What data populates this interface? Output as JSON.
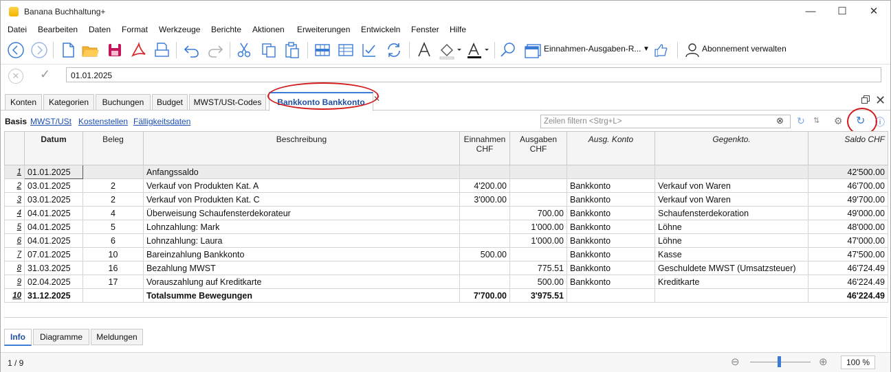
{
  "window": {
    "title": "Banana Buchhaltung+"
  },
  "menu": [
    "Datei",
    "Bearbeiten",
    "Daten",
    "Format",
    "Werkzeuge",
    "Berichte",
    "Aktionen",
    "Erweiterungen",
    "Entwickeln",
    "Fenster",
    "Hilfe"
  ],
  "toolbar": {
    "layout_selector": "Einnahmen-Ausgaben-R...",
    "subscription_label": "Abonnement verwalten"
  },
  "formula_bar": {
    "value": "01.01.2025"
  },
  "tabs": [
    "Konten",
    "Kategorien",
    "Buchungen",
    "Budget",
    "MWST/USt-Codes",
    "Bankkonto Bankkonto"
  ],
  "active_tab": "Bankkonto Bankkonto",
  "views": {
    "active": "Basis",
    "links": [
      "MWST/USt",
      "Kostenstellen",
      "Fälligkeitsdaten"
    ]
  },
  "filter": {
    "placeholder": "Zeilen filtern <Strg+L>"
  },
  "table": {
    "headers": {
      "datum": "Datum",
      "beleg": "Beleg",
      "beschreibung": "Beschreibung",
      "einnahmen": "Einnahmen CHF",
      "ausgaben": "Ausgaben CHF",
      "ausg_konto": "Ausg. Konto",
      "gegenkto": "Gegenkto.",
      "saldo": "Saldo CHF"
    },
    "rows": [
      {
        "n": "1",
        "datum": "01.01.2025",
        "beleg": "",
        "beschreibung": "Anfangssaldo",
        "einnahmen": "",
        "ausgaben": "",
        "konto": "",
        "gegenkto": "",
        "saldo": "42'500.00"
      },
      {
        "n": "2",
        "datum": "03.01.2025",
        "beleg": "2",
        "beschreibung": "Verkauf von Produkten Kat. A",
        "einnahmen": "4'200.00",
        "ausgaben": "",
        "konto": "Bankkonto",
        "gegenkto": "Verkauf von Waren",
        "saldo": "46'700.00"
      },
      {
        "n": "3",
        "datum": "03.01.2025",
        "beleg": "2",
        "beschreibung": "Verkauf von Produkten Kat. C",
        "einnahmen": "3'000.00",
        "ausgaben": "",
        "konto": "Bankkonto",
        "gegenkto": "Verkauf von Waren",
        "saldo": "49'700.00"
      },
      {
        "n": "4",
        "datum": "04.01.2025",
        "beleg": "4",
        "beschreibung": "Überweisung Schaufensterdekorateur",
        "einnahmen": "",
        "ausgaben": "700.00",
        "konto": "Bankkonto",
        "gegenkto": "Schaufensterdekoration",
        "saldo": "49'000.00"
      },
      {
        "n": "5",
        "datum": "04.01.2025",
        "beleg": "5",
        "beschreibung": "Lohnzahlung: Mark",
        "einnahmen": "",
        "ausgaben": "1'000.00",
        "konto": "Bankkonto",
        "gegenkto": "Löhne",
        "saldo": "48'000.00"
      },
      {
        "n": "6",
        "datum": "04.01.2025",
        "beleg": "6",
        "beschreibung": "Lohnzahlung: Laura",
        "einnahmen": "",
        "ausgaben": "1'000.00",
        "konto": "Bankkonto",
        "gegenkto": "Löhne",
        "saldo": "47'000.00"
      },
      {
        "n": "7",
        "datum": "07.01.2025",
        "beleg": "10",
        "beschreibung": "Bareinzahlung Bankkonto",
        "einnahmen": "500.00",
        "ausgaben": "",
        "konto": "Bankkonto",
        "gegenkto": "Kasse",
        "saldo": "47'500.00"
      },
      {
        "n": "8",
        "datum": "31.03.2025",
        "beleg": "16",
        "beschreibung": "Bezahlung MWST",
        "einnahmen": "",
        "ausgaben": "775.51",
        "konto": "Bankkonto",
        "gegenkto": "Geschuldete MWST (Umsatzsteuer)",
        "saldo": "46'724.49"
      },
      {
        "n": "9",
        "datum": "02.04.2025",
        "beleg": "17",
        "beschreibung": "Vorauszahlung auf Kreditkarte",
        "einnahmen": "",
        "ausgaben": "500.00",
        "konto": "Bankkonto",
        "gegenkto": "Kreditkarte",
        "saldo": "46'224.49"
      },
      {
        "n": "10",
        "datum": "31.12.2025",
        "beleg": "",
        "beschreibung": "Totalsumme Bewegungen",
        "einnahmen": "7'700.00",
        "ausgaben": "3'975.51",
        "konto": "",
        "gegenkto": "",
        "saldo": "46'224.49"
      }
    ]
  },
  "bottom_tabs": [
    "Info",
    "Diagramme",
    "Meldungen"
  ],
  "status": {
    "page": "1 / 9",
    "zoom": "100 %"
  },
  "colors": {
    "link": "#1a4db3",
    "active_tab": "#1f4fa0",
    "annotation": "#d21b1b",
    "toolbar_blue": "#3a7bd5"
  }
}
